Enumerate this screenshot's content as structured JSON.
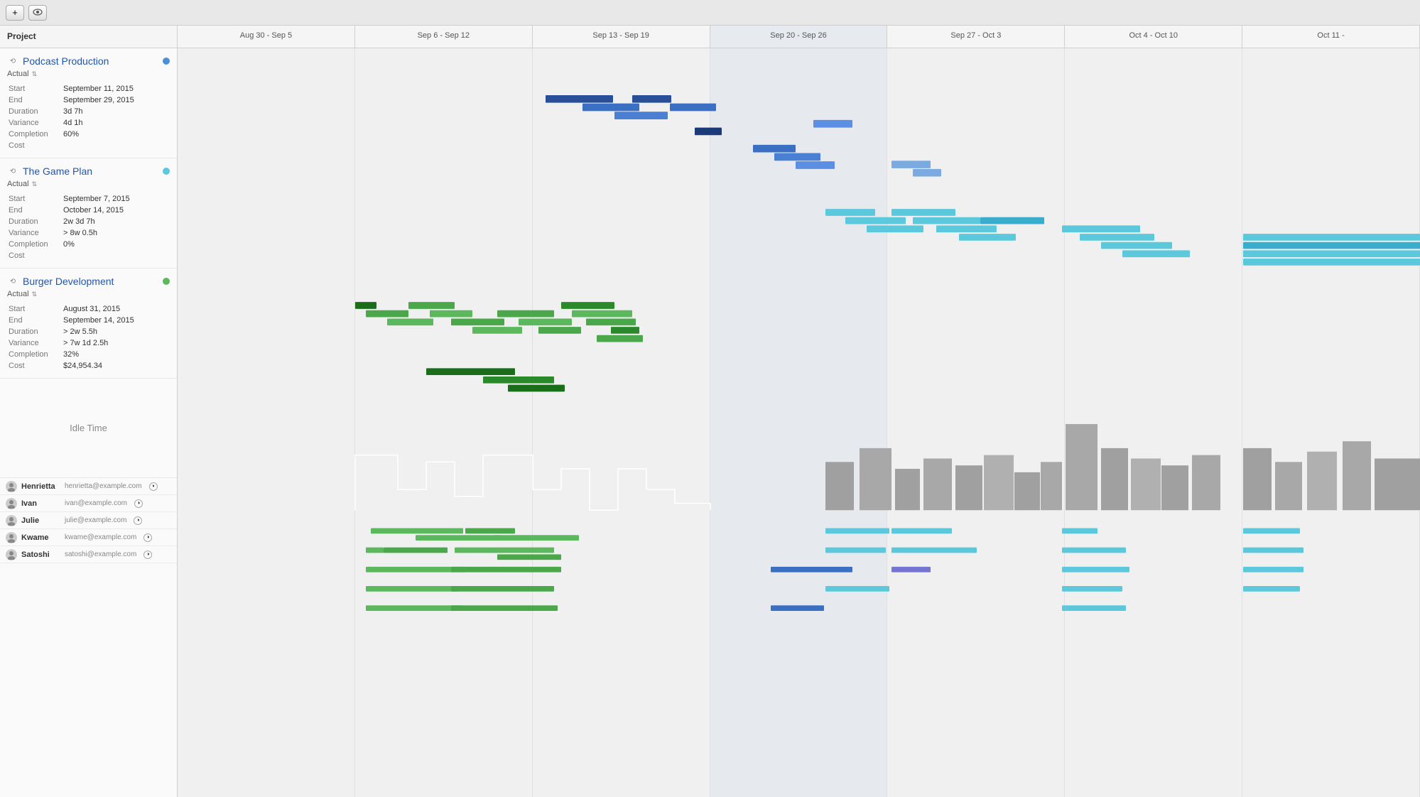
{
  "toolbar": {
    "add_button_label": "+",
    "view_button_label": "👁"
  },
  "header": {
    "project_col": "Project",
    "weeks": [
      "Aug 30 - Sep 5",
      "Sep 6 - Sep 12",
      "Sep 13 - Sep 19",
      "Sep 20 - Sep 26",
      "Sep 27 - Oct 3",
      "Oct 4 - Oct 10",
      "Oct 11 -"
    ]
  },
  "projects": [
    {
      "id": "podcast",
      "icon": "⟲",
      "title": "Podcast Production",
      "dot_color": "blue",
      "actual_label": "Actual",
      "start_label": "Start",
      "start_value": "September 11, 2015",
      "end_label": "End",
      "end_value": "September 29, 2015",
      "duration_label": "Duration",
      "duration_value": "3d 7h",
      "variance_label": "Variance",
      "variance_value": "4d 1h",
      "completion_label": "Completion",
      "completion_value": "60%",
      "cost_label": "Cost",
      "cost_value": ""
    },
    {
      "id": "gameplan",
      "icon": "⟲",
      "title": "The Game Plan",
      "dot_color": "cyan",
      "actual_label": "Actual",
      "start_label": "Start",
      "start_value": "September 7, 2015",
      "end_label": "End",
      "end_value": "October 14, 2015",
      "duration_label": "Duration",
      "duration_value": "2w 3d 7h",
      "variance_label": "Variance",
      "variance_value": "> 8w 0.5h",
      "completion_label": "Completion",
      "completion_value": "0%",
      "cost_label": "Cost",
      "cost_value": ""
    },
    {
      "id": "burger",
      "icon": "⟲",
      "title": "Burger Development",
      "dot_color": "green",
      "actual_label": "Actual",
      "start_label": "Start",
      "start_value": "August 31, 2015",
      "end_label": "End",
      "end_value": "September 14, 2015",
      "duration_label": "Duration",
      "duration_value": "> 2w 5.5h",
      "variance_label": "Variance",
      "variance_value": "> 7w 1d 2.5h",
      "completion_label": "Completion",
      "completion_value": "32%",
      "cost_label": "Cost",
      "cost_value": "$24,954.34"
    }
  ],
  "idle_time": {
    "label": "Idle Time"
  },
  "resources": [
    {
      "name": "Henrietta",
      "email": "henrietta@example.com",
      "has_indicator": true
    },
    {
      "name": "Ivan",
      "email": "ivan@example.com",
      "has_indicator": true
    },
    {
      "name": "Julie",
      "email": "julie@example.com",
      "has_indicator": true
    },
    {
      "name": "Kwame",
      "email": "kwame@example.com",
      "has_indicator": true
    },
    {
      "name": "Satoshi",
      "email": "satoshi@example.com",
      "has_indicator": true
    }
  ]
}
